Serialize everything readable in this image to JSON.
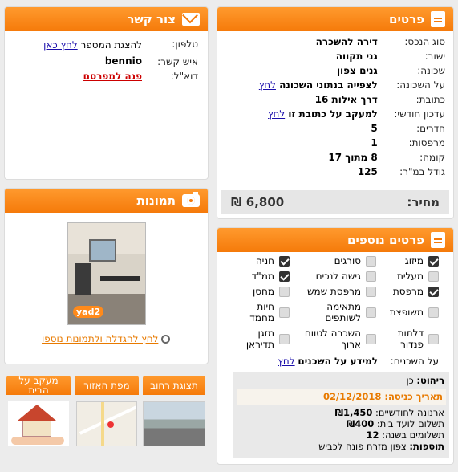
{
  "details": {
    "title": "פרטים",
    "rows": [
      {
        "label": "סוג הנכס:",
        "value": "דירה להשכרה"
      },
      {
        "label": "ישוב:",
        "value": "גני תקווה"
      },
      {
        "label": "שכונה:",
        "value": "גנים צפון"
      },
      {
        "label": "על השכונה:",
        "value": "לצפייה בנתוני השכונה",
        "link": "לחץ"
      },
      {
        "label": "כתובת:",
        "value": "דרך אילות 16"
      },
      {
        "label": "עדכון חודשי:",
        "value": "למעקב על כתובת זו",
        "link": "לחץ"
      },
      {
        "label": "חדרים:",
        "value": "5"
      },
      {
        "label": "מרפסות:",
        "value": "1"
      },
      {
        "label": "קומה:",
        "value": "8 מתוך 17"
      },
      {
        "label": "גודל במ\"ר:",
        "value": "125"
      }
    ],
    "price_label": "מחיר:",
    "price_value": "6,800 ₪"
  },
  "contact": {
    "title": "צור קשר",
    "phone_label": "טלפון:",
    "phone_text": "להצגת המספר",
    "phone_link": "לחץ כאן",
    "person_label": "איש קשר:",
    "person_value": "bennio",
    "email_label": "דוא\"ל:",
    "email_link": "פנה למפרסם"
  },
  "photos": {
    "title": "תמונות",
    "watermark": "yad2",
    "enlarge_link": "לחץ להגדלה ולתמונות נוספו"
  },
  "extras": {
    "title": "פרטים נוספים",
    "features": [
      {
        "label": "מיזוג",
        "on": true
      },
      {
        "label": "סורגים",
        "on": false
      },
      {
        "label": "חניה",
        "on": true
      },
      {
        "label": "מעלית",
        "on": false
      },
      {
        "label": "גישה לנכים",
        "on": false
      },
      {
        "label": "ממ\"ד",
        "on": true
      },
      {
        "label": "מרפסת",
        "on": true
      },
      {
        "label": "מרפסת שמש",
        "on": false
      },
      {
        "label": "מחסן",
        "on": false
      },
      {
        "label": "משופצת",
        "on": false
      },
      {
        "label": "מתאימה לשותפים",
        "on": false
      },
      {
        "label": "חיות מחמד",
        "on": false
      },
      {
        "label": "דלתות פנדור",
        "on": false
      },
      {
        "label": "השכרה לטווח ארוך",
        "on": false
      },
      {
        "label": "מזגן תדיראן",
        "on": false
      }
    ],
    "neighbors_label": "על השכנים:",
    "neighbors_text": "למידע על השכנים",
    "neighbors_link": "לחץ"
  },
  "info": {
    "furniture_label": "ריהוט:",
    "furniture_value": "כן",
    "entry_label": "תאריך כניסה:",
    "entry_value": "02/12/2018",
    "arnona_label": "ארנונה לחודשיים:",
    "arnona_value": "₪1,450",
    "vaad_label": "תשלום לועד בית:",
    "vaad_value": "₪400",
    "payments_label": "תשלומים בשנה:",
    "payments_value": "12",
    "extras_label": "תוספות:",
    "extras_value": "צפון מזרח פונה לכביש"
  },
  "thumbs": {
    "street_view": "תצוגת רחוב",
    "area_map": "מפת האזור",
    "track_home": "מעקב על הבית"
  }
}
